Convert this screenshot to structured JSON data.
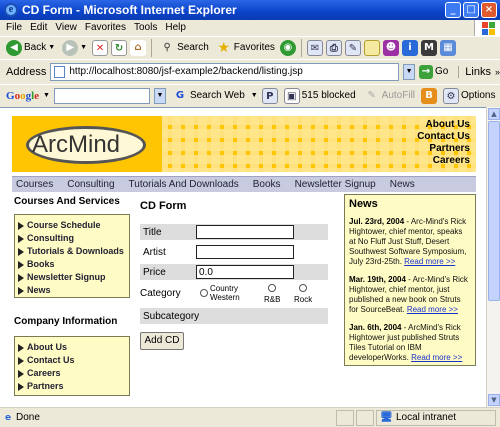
{
  "window": {
    "title": "CD Form - Microsoft Internet Explorer"
  },
  "menu": [
    "File",
    "Edit",
    "View",
    "Favorites",
    "Tools",
    "Help"
  ],
  "toolbar": {
    "back": "Back",
    "search": "Search",
    "favorites": "Favorites"
  },
  "address": {
    "label": "Address",
    "url": "http://localhost:8080/jsf-example2/backend/listing.jsp",
    "go": "Go",
    "links": "Links"
  },
  "google": {
    "logo": "Google",
    "search_web": "Search Web",
    "blocked": "515 blocked",
    "autofill": "AutoFill",
    "options": "Options"
  },
  "page": {
    "logo": "ArcMind",
    "banner_links": [
      "About Us",
      "Contact Us",
      "Partners",
      "Careers"
    ],
    "nav": [
      "Courses",
      "Consulting",
      "Tutorials And Downloads",
      "Books",
      "Newsletter Signup",
      "News"
    ],
    "sidebar": {
      "title1": "Courses And Services",
      "items1": [
        "Course Schedule",
        "Consulting",
        "Tutorials & Downloads",
        "Books",
        "Newsletter Signup",
        "News"
      ],
      "title2": "Company Information",
      "items2": [
        "About Us",
        "Contact Us",
        "Careers",
        "Partners"
      ]
    },
    "form": {
      "title": "CD Form",
      "title_label": "Title",
      "artist_label": "Artist",
      "price_label": "Price",
      "price_value": "0.0",
      "category_label": "Category",
      "categories": [
        "Country Western",
        "R&B",
        "Rock"
      ],
      "subcategory_label": "Subcategory",
      "add_button": "Add CD"
    },
    "news": {
      "title": "News",
      "items": [
        {
          "date": "Jul. 23rd, 2004",
          "text": " - Arc-Mind's Rick Hightower, chief mentor, speaks at No Fluff Just Stuff, Desert Southwest Software Symposium, July 23rd-25th.",
          "link": "Read more >>"
        },
        {
          "date": "Mar. 19th, 2004",
          "text": " - Arc-Mind's Rick Hightower, chief mentor, just published a new book on Struts for SourceBeat.",
          "link": "Read more >>"
        },
        {
          "date": "Jan. 6th, 2004",
          "text": " - ArcMind's Rick Hightower just published Struts Tiles Tutorial on IBM developerWorks.",
          "link": "Read more >>"
        }
      ]
    }
  },
  "status": {
    "left": "Done",
    "zone": "Local intranet"
  }
}
